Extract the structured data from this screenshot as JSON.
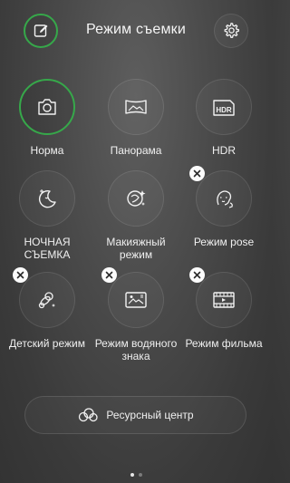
{
  "header": {
    "title": "Режим съемки",
    "edit_icon": "edit-icon",
    "settings_icon": "gear-icon"
  },
  "modes": [
    {
      "label": "Норма",
      "icon": "camera-icon",
      "selected": true,
      "removable": false
    },
    {
      "label": "Панорама",
      "icon": "panorama-icon",
      "selected": false,
      "removable": false
    },
    {
      "label": "HDR",
      "icon": "hdr-icon",
      "selected": false,
      "removable": false
    },
    {
      "label": "НОЧНАЯ\nСЪЕМКА",
      "icon": "night-moon-icon",
      "selected": false,
      "removable": false
    },
    {
      "label": "Макияжный\nрежим",
      "icon": "makeup-icon",
      "selected": false,
      "removable": false
    },
    {
      "label": "Режим pose",
      "icon": "pose-icon",
      "selected": false,
      "removable": true
    },
    {
      "label": "Детский режим",
      "icon": "pacifier-icon",
      "selected": false,
      "removable": true
    },
    {
      "label": "Режим водяного\nзнака",
      "icon": "watermark-icon",
      "selected": false,
      "removable": true
    },
    {
      "label": "Режим фильма",
      "icon": "film-icon",
      "selected": false,
      "removable": true
    }
  ],
  "resource_center": {
    "label": "Ресурсный центр",
    "icon": "cloud-icon"
  },
  "pagination": {
    "current": 1,
    "total": 2
  },
  "colors": {
    "accent": "#36a84a",
    "badge": "#fbfbfb"
  }
}
